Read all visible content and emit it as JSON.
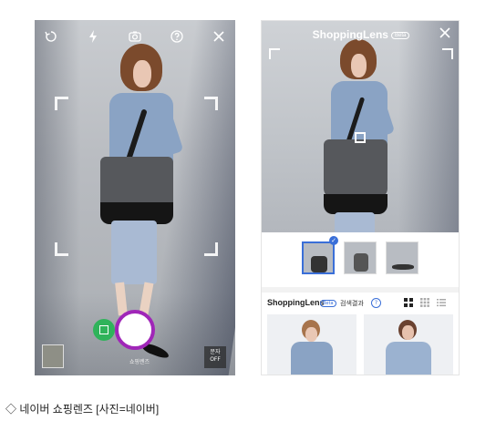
{
  "left_phone": {
    "text_button": {
      "line1": "문자",
      "line2": "OFF"
    },
    "mode_labels": "쇼핑렌즈"
  },
  "right_phone": {
    "title": "ShoppingLens",
    "beta": "Beta",
    "results_header": {
      "brand": "ShoppingLens",
      "beta": "Beta",
      "label": "검색결과",
      "help": "?"
    }
  },
  "caption": "◇ 네이버 쇼핑렌즈 [사진=네이버]",
  "colors": {
    "shutter_ring": "#a026b8",
    "lens_toggle": "#2fb35a",
    "accent": "#3a6fd8"
  }
}
